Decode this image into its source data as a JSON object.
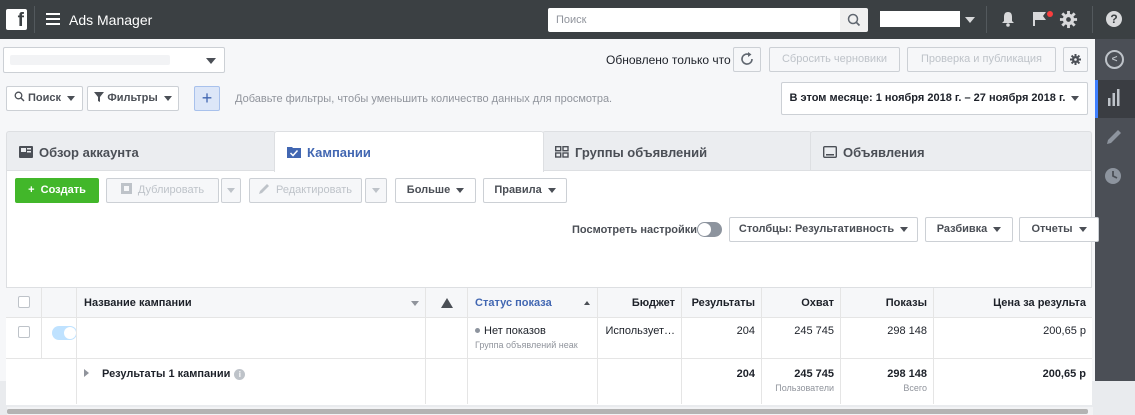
{
  "app": {
    "name": "Ads Manager",
    "search_placeholder": "Поиск"
  },
  "toolbar": {
    "updated": "Обновлено только что",
    "discard": "Сбросить черновики",
    "review_publish": "Проверка и публикация"
  },
  "filters": {
    "search": "Поиск",
    "filters": "Фильтры",
    "hint": "Добавьте фильтры, чтобы уменьшить количество данных для просмотра.",
    "date_range": "В этом месяце: 1 ноября 2018 г. – 27 ноября 2018 г."
  },
  "tabs": [
    {
      "label": "Обзор аккаунта"
    },
    {
      "label": "Кампании"
    },
    {
      "label": "Группы объявлений"
    },
    {
      "label": "Объявления"
    }
  ],
  "actions": {
    "create": "Создать",
    "duplicate": "Дублировать",
    "edit": "Редактировать",
    "more": "Больше",
    "rules": "Правила"
  },
  "view": {
    "view_settings": "Посмотреть настройки",
    "columns": "Столбцы: Результативность",
    "breakdown": "Разбивка",
    "reports": "Отчеты"
  },
  "table": {
    "headers": {
      "name": "Название кампании",
      "status": "Статус показа",
      "budget": "Бюджет",
      "results": "Результаты",
      "reach": "Охват",
      "impressions": "Показы",
      "cost": "Цена за результа"
    },
    "row": {
      "status": "Нет показов",
      "status_sub": "Группа объявлений неак",
      "budget": "Использует…",
      "results": "204",
      "reach": "245 745",
      "impressions": "298 148",
      "cost": "200,65 р"
    },
    "total": {
      "label": "Результаты 1 кампании",
      "results": "204",
      "reach": "245 745",
      "reach_sub": "Пользователи",
      "impressions": "298 148",
      "impressions_sub": "Всего",
      "cost": "200,65 р"
    }
  },
  "icons": {
    "facebook": "facebook-logo",
    "menu": "menu-icon",
    "search": "search-icon",
    "notifications": "bell-icon",
    "flag": "flag-icon",
    "settings": "gear-icon",
    "help": "help-icon"
  },
  "colors": {
    "topbar": "#3b4043",
    "accent": "#4267b2",
    "create": "#42b72a"
  }
}
